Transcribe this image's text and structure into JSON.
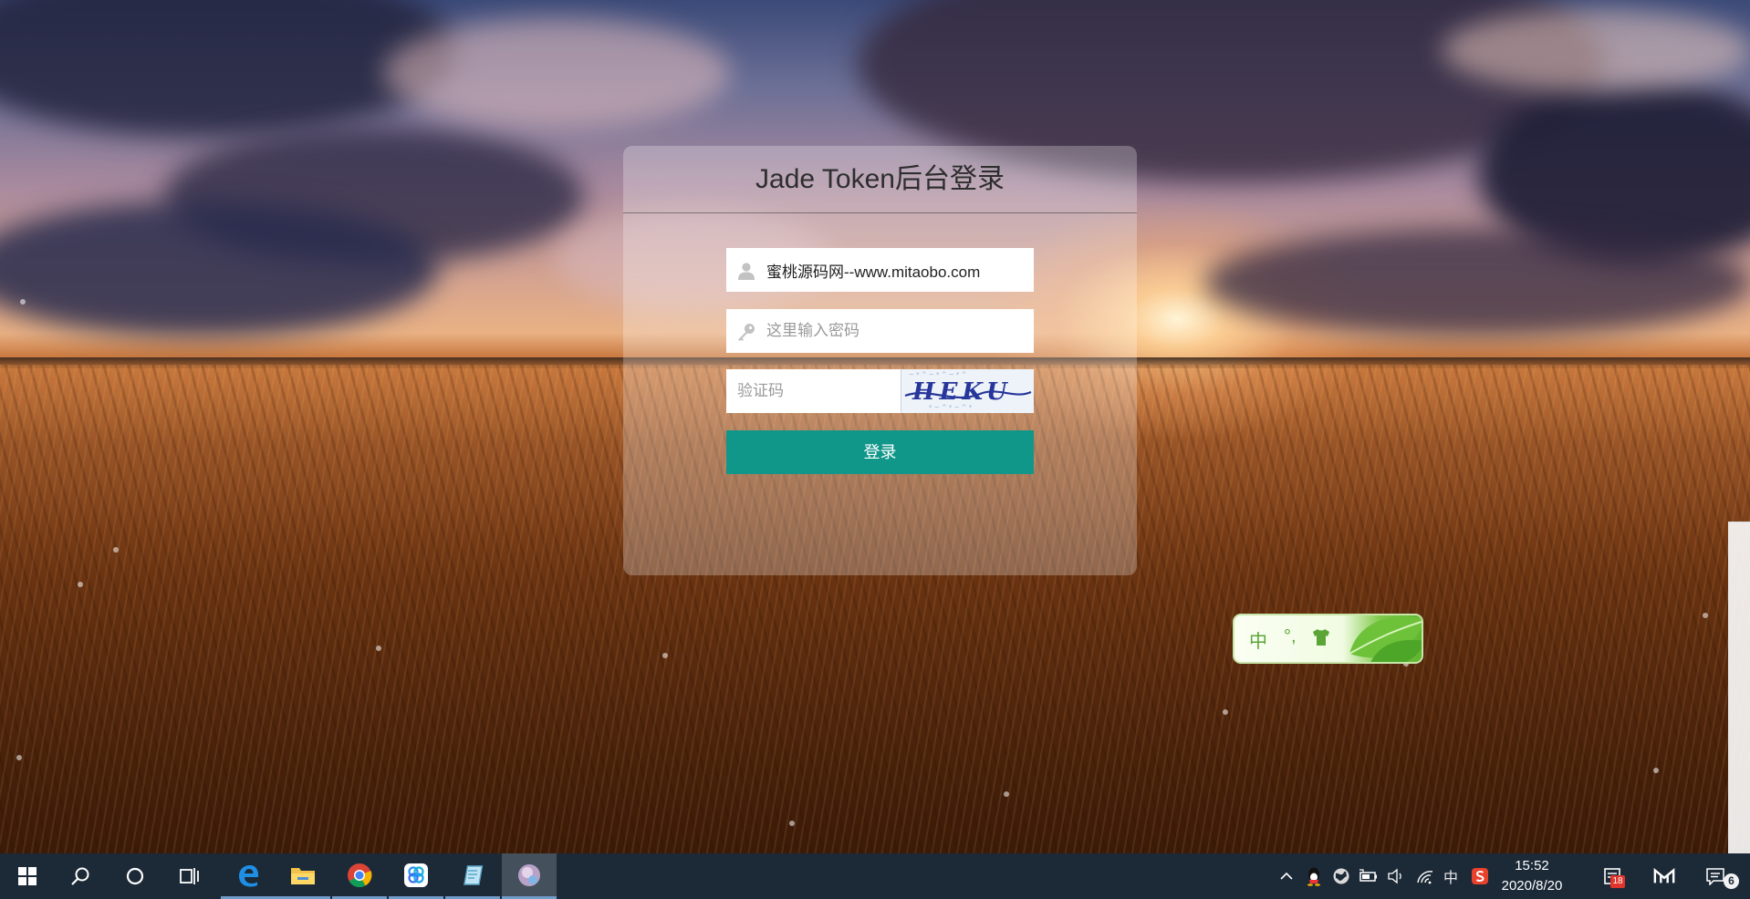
{
  "login": {
    "title": "Jade Token后台登录",
    "username_value": "蜜桃源码网--www.mitaobo.com",
    "password_placeholder": "这里输入密码",
    "captcha_placeholder": "验证码",
    "captcha_text": "HEKU",
    "submit_label": "登录"
  },
  "ime": {
    "language": "中",
    "punctuation": "°,",
    "skin_icon": "shirt-icon",
    "decor_icon": "leaf-icon"
  },
  "taskbar": {
    "apps": [
      "windows-start-icon",
      "search-icon",
      "cortana-icon",
      "task-view-icon",
      "edge-icon",
      "file-explorer-icon",
      "chrome-icon",
      "pinwheel-app-icon",
      "notepad-icon",
      "browser-app-icon"
    ],
    "tray": {
      "ime_indicator": "中",
      "time": "15:52",
      "date": "2020/8/20",
      "messages_badge": "18",
      "notification_count": "6"
    }
  },
  "colors": {
    "login_button": "#11978a",
    "taskbar": "#1c2a38",
    "ime_accent": "#5ba537"
  }
}
